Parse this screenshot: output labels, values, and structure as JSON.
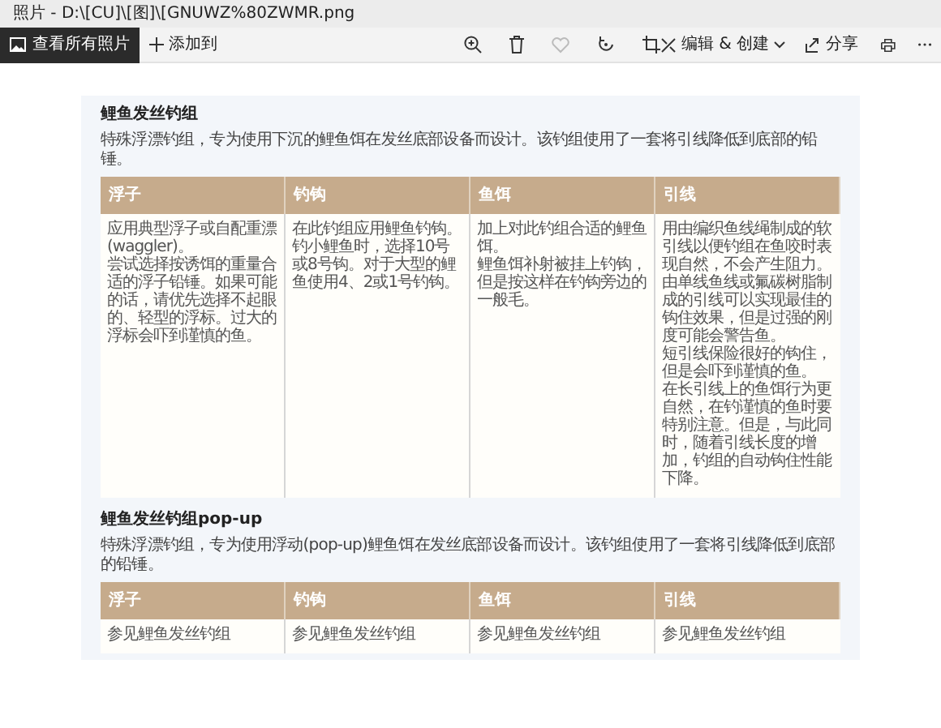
{
  "window": {
    "title": "照片 - D:\\[CU]\\[图]\\[GNUWZ%80ZWMR.png"
  },
  "toolbar": {
    "view_all": "查看所有照片",
    "add_to": "添加到",
    "edit_create": "编辑 & 创建",
    "share": "分享"
  },
  "sections": [
    {
      "heading": "鲤鱼发丝钓组",
      "description": "特殊浮漂钓组，专为使用下沉的鲤鱼饵在发丝底部设备而设计。该钓组使用了一套将引线降低到底部的铅锤。",
      "columns": [
        "浮子",
        "钓钩",
        "鱼饵",
        "引线"
      ],
      "rows": [
        [
          [
            "应用典型浮子或自配重漂(waggler)。",
            "尝试选择按诱饵的重量合适的浮子铅锤。如果可能的话，请优先选择不起眼的、轻型的浮标。过大的浮标会吓到谨慎的鱼。"
          ],
          [
            "在此钓组应用鲤鱼钓钩。钓小鲤鱼时，选择10号或8号钩。对于大型的鲤鱼使用4、2或1号钓钩。"
          ],
          [
            "加上对此钓组合适的鲤鱼饵。",
            "鲤鱼饵补射被挂上钓钩，但是按这样在钓钩旁边的一般毛。"
          ],
          [
            "用由编织鱼线绳制成的软引线以便钓组在鱼咬时表现自然，不会产生阻力。",
            "由单线鱼线或氟碳树脂制成的引线可以实现最佳的钩住效果，但是过强的刚度可能会警告鱼。",
            "短引线保险很好的钩住，但是会吓到谨慎的鱼。",
            "在长引线上的鱼饵行为更自然，在钓谨慎的鱼时要特别注意。但是，与此同时，随着引线长度的增加，钓组的自动钩住性能下降。"
          ]
        ]
      ]
    },
    {
      "heading": "鲤鱼发丝钓组pop-up",
      "description": "特殊浮漂钓组，专为使用浮动(pop-up)鲤鱼饵在发丝底部设备而设计。该钓组使用了一套将引线降低到底部的铅锤。",
      "columns": [
        "浮子",
        "钓钩",
        "鱼饵",
        "引线"
      ],
      "rows": [
        [
          [
            "参见鲤鱼发丝钓组"
          ],
          [
            "参见鲤鱼发丝钓组"
          ],
          [
            "参见鲤鱼发丝钓组"
          ],
          [
            "参见鲤鱼发丝钓组"
          ]
        ]
      ]
    }
  ]
}
